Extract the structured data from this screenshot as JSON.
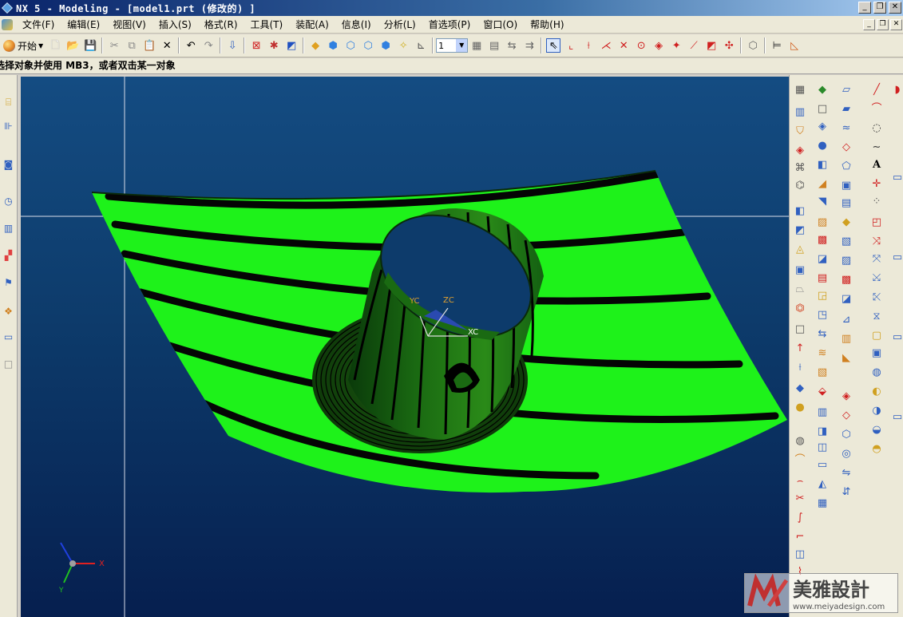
{
  "window": {
    "title": "NX 5 - Modeling - [model1.prt  (修改的) ]",
    "controls": {
      "minimize": "_",
      "restore": "❐",
      "close": "✕"
    }
  },
  "menu": {
    "items": [
      {
        "label": "文件(F)"
      },
      {
        "label": "编辑(E)"
      },
      {
        "label": "视图(V)"
      },
      {
        "label": "插入(S)"
      },
      {
        "label": "格式(R)"
      },
      {
        "label": "工具(T)"
      },
      {
        "label": "装配(A)"
      },
      {
        "label": "信息(I)"
      },
      {
        "label": "分析(L)"
      },
      {
        "label": "首选项(P)"
      },
      {
        "label": "窗口(O)"
      },
      {
        "label": "帮助(H)"
      }
    ],
    "mdi_controls": {
      "minimize": "_",
      "restore": "❐",
      "close": "✕"
    }
  },
  "toolbar": {
    "start_label": "开始",
    "layer_combo_value": "1",
    "icons": [
      "new-icon",
      "open-icon",
      "save-icon",
      "cut-icon",
      "copy-icon",
      "paste-icon",
      "delete-icon",
      "undo-icon",
      "redo-icon",
      "command-finder-icon",
      "sketch-icon",
      "feature-icon",
      "render-style-icon",
      "shaded-icon",
      "wireframe-icon",
      "static-wireframe-icon",
      "studio-icon",
      "face-analysis-icon",
      "snap-icon",
      "work-layer-icon",
      "layer-settings-icon",
      "select-icon",
      "point-icon",
      "curve-icon",
      "analysis-icon"
    ]
  },
  "cue_line": {
    "text": "选择对象并使用 MB3，或者双击某一对象"
  },
  "viewport": {
    "background_top": "#144c82",
    "background_bottom": "#061f4f",
    "surface_color": "#1ef21a",
    "stripe_color": "#000000",
    "triad_labels": {
      "xc": "XC",
      "yc": "YC",
      "zc": "ZC"
    },
    "view_triad_labels": {
      "x": "X",
      "y": "Y"
    }
  },
  "watermark": {
    "brand": "美雅設計",
    "url": "www.meiyadesign.com"
  }
}
